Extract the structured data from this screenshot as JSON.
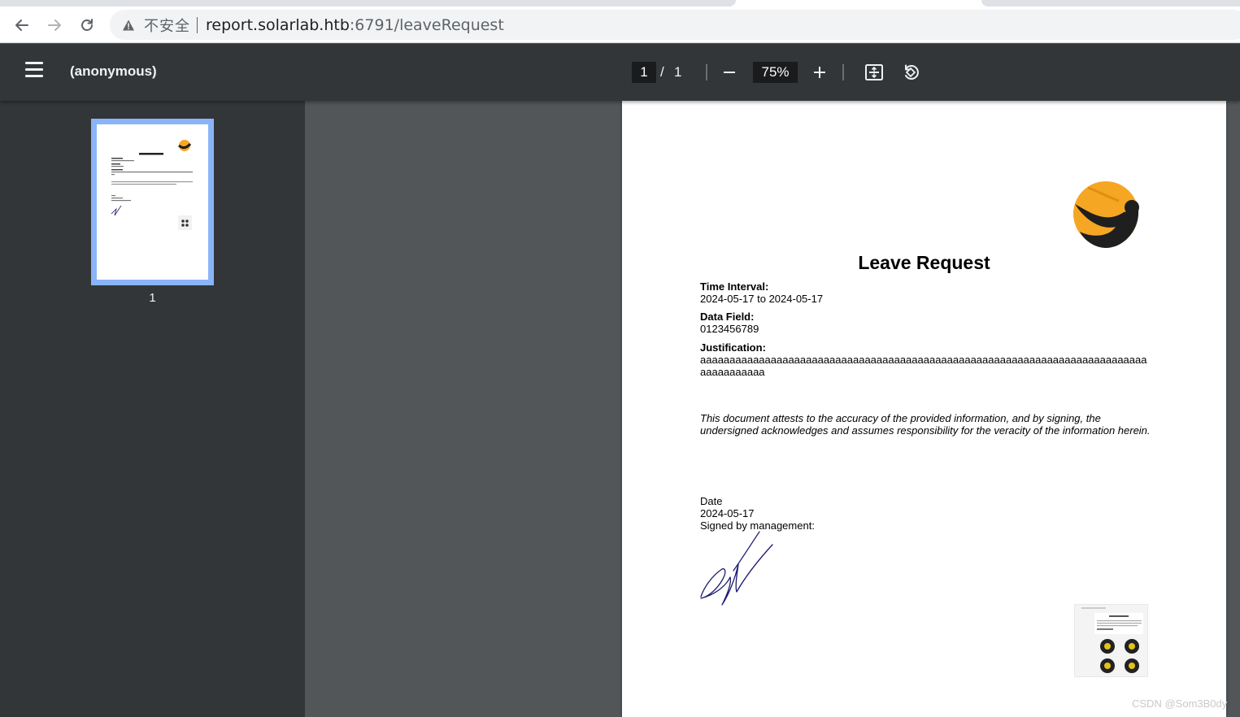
{
  "browser": {
    "security_label": "不安全",
    "url_host": "report.solarlab.htb",
    "url_path": ":6791/leaveRequest"
  },
  "viewer": {
    "title": "(anonymous)",
    "current_page": "1",
    "page_separator": "/",
    "total_pages": "1",
    "zoom": "75%"
  },
  "sidebar": {
    "thumbnail_label": "1"
  },
  "document": {
    "heading": "Leave Request",
    "time_interval_label": "Time Interval:",
    "time_interval_value": "2024-05-17 to 2024-05-17",
    "data_field_label": "Data Field:",
    "data_field_value": "0123456789",
    "justification_label": "Justification:",
    "justification_value": "aaaaaaaaaaaaaaaaaaaaaaaaaaaaaaaaaaaaaaaaaaaaaaaaaaaaaaaaaaaaaaaaaaaaaaaaaaaaaaaaaaaaaaa",
    "attestation": "This document attests to the accuracy of the provided information, and by signing, the undersigned acknowledges and assumes responsibility for the veracity of the information herein.",
    "date_label": "Date",
    "date_value": "2024-05-17",
    "signed_label": "Signed by management:"
  },
  "watermark": "CSDN @Som3B0dy",
  "colors": {
    "pdf_toolbar": "#323639",
    "viewer_background": "#525659",
    "thumbnail_highlight": "#8ab4f8",
    "logo_orange": "#f5a623",
    "logo_dark": "#1f1f1f",
    "signature_ink": "#1a1a6e"
  },
  "icons": {
    "back": "arrow-left-icon",
    "forward": "arrow-right-icon",
    "reload": "reload-icon",
    "warning": "warning-triangle-icon",
    "menu": "hamburger-menu-icon",
    "zoom_out": "minus-icon",
    "zoom_in": "plus-icon",
    "fit": "fit-to-page-icon",
    "rotate": "rotate-counterclockwise-icon"
  }
}
